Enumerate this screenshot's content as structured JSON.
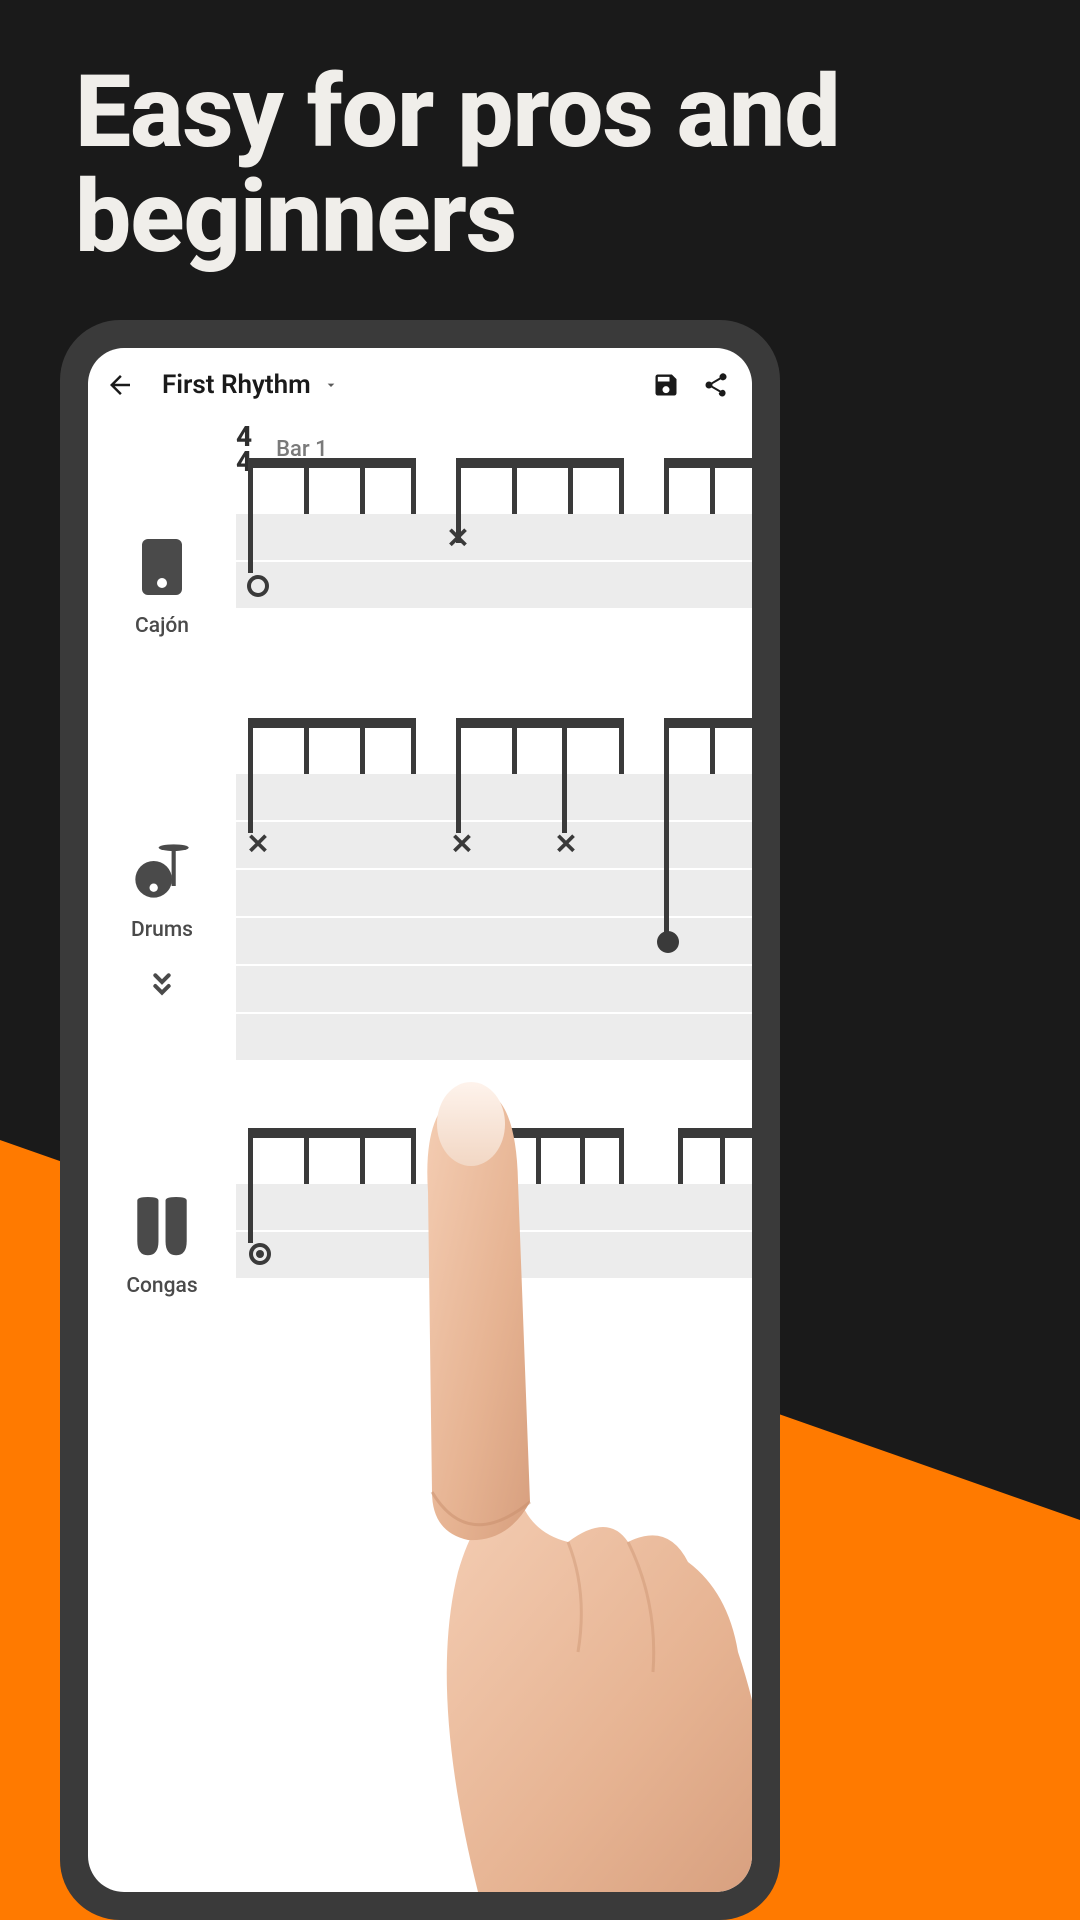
{
  "marketing": {
    "headline": "Easy for pros and beginners"
  },
  "topbar": {
    "title": "First Rhythm"
  },
  "timesig": {
    "top": "4",
    "bottom": "4",
    "bar_label": "Bar 1"
  },
  "instruments": {
    "cajon": "Cajón",
    "drums": "Drums",
    "congas": "Congas"
  },
  "colors": {
    "accent": "#ff7a00",
    "ink": "#3a3a3a"
  }
}
